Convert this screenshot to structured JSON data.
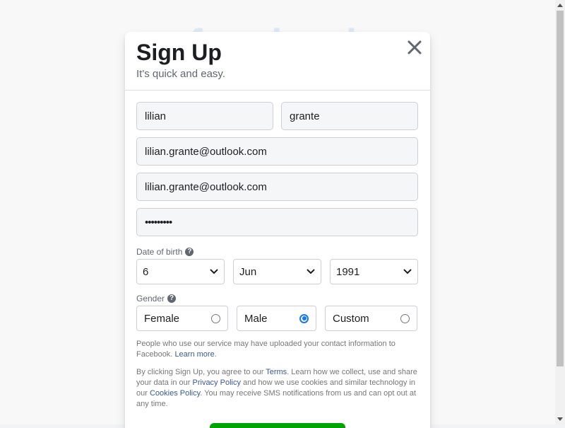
{
  "modal": {
    "title": "Sign Up",
    "subtitle": "It's quick and easy."
  },
  "form": {
    "first_name": "lilian",
    "last_name": "grante",
    "email": "lilian.grante@outlook.com",
    "email_confirm": "lilian.grante@outlook.com",
    "password": "•••••••••",
    "dob_label": "Date of birth",
    "dob": {
      "day": "6",
      "month": "Jun",
      "year": "1991"
    },
    "gender_label": "Gender",
    "gender_options": [
      {
        "label": "Female",
        "checked": false
      },
      {
        "label": "Male",
        "checked": true
      },
      {
        "label": "Custom",
        "checked": false
      }
    ]
  },
  "notice": {
    "contact_text": "People who use our service may have uploaded your contact information to Facebook.",
    "learn_more": "Learn more",
    "terms_1": "By clicking Sign Up, you agree to our",
    "terms_link": "Terms",
    "terms_2": ". Learn how we collect, use and share your data in our",
    "privacy_link": "Privacy Policy",
    "terms_3": "and how we use cookies and similar technology in our",
    "cookies_link": "Cookies Policy",
    "terms_4": ". You may receive SMS notifications from us and can opt out at any time."
  },
  "colors": {
    "accent": "#1877f2",
    "link": "#385898",
    "signup_green": "#00a400"
  },
  "icons": {
    "close": "close-icon",
    "help": "help-circle-icon",
    "chevron": "chevron-down-icon"
  }
}
